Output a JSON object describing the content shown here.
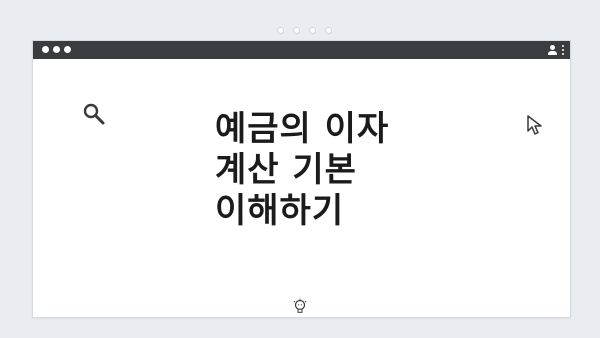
{
  "page": {
    "background": "#e9ecf1"
  },
  "browser": {
    "titlebar_color": "#3b3c3f",
    "traffic_lights": [
      "dot",
      "dot",
      "dot"
    ],
    "icons": {
      "account": "user-icon",
      "menu": "kebab-menu-icon"
    }
  },
  "content": {
    "headline_lines": [
      "예금의 이자",
      "계산 기본",
      "이해하기"
    ],
    "icons": {
      "search": "magnifier-icon",
      "cursor": "mouse-pointer-icon",
      "idea": "lightbulb-icon"
    }
  }
}
